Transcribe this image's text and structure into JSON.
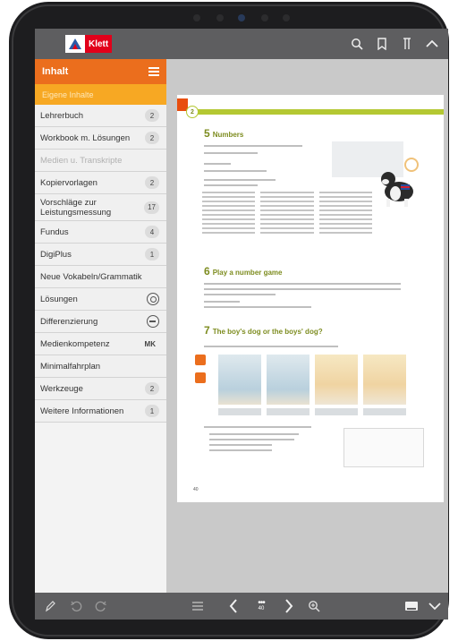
{
  "app": {
    "logo_text": "Klett",
    "brand_color": "#e2001a",
    "accent_color": "#eb6e1d"
  },
  "topbar": {
    "icons": [
      "search-icon",
      "bookmark-icon",
      "marker-icon",
      "chevron-up-icon"
    ]
  },
  "sidebar": {
    "title": "Inhalt",
    "subtitle": "Eigene Inhalte",
    "items": [
      {
        "label": "Lehrerbuch",
        "badge": "2"
      },
      {
        "label": "Workbook m. Lösungen",
        "badge": "2"
      },
      {
        "label": "Medien u. Transkripte",
        "badge": ""
      },
      {
        "label": "Kopiervorlagen",
        "badge": "2"
      },
      {
        "label": "Vorschläge zur Leistungsmessung",
        "badge": "17"
      },
      {
        "label": "Fundus",
        "badge": "4"
      },
      {
        "label": "DigiPlus",
        "badge": "1"
      },
      {
        "label": "Neue Vokabeln/Grammatik",
        "badge": ""
      },
      {
        "label": "Lösungen",
        "badge": ""
      },
      {
        "label": "Differenzierung",
        "badge": ""
      },
      {
        "label": "Medienkompetenz",
        "badge": "MK"
      },
      {
        "label": "Minimalfahrplan",
        "badge": ""
      },
      {
        "label": "Werkzeuge",
        "badge": "2"
      },
      {
        "label": "Weitere Informationen",
        "badge": "1"
      }
    ]
  },
  "page": {
    "unit_label": "2",
    "ex5_number": "5",
    "ex5_title": "Numbers",
    "ex6_number": "6",
    "ex6_title": "Play a number game",
    "ex7_number": "7",
    "ex7_title": "The boy's dog or the boys' dog?",
    "page_number": "40"
  },
  "bottombar": {
    "icons": [
      "pen-icon",
      "undo-icon",
      "redo-icon",
      "list-icon",
      "prev-page-icon",
      "next-page-icon",
      "zoom-icon",
      "single-page-icon",
      "chevron-down-icon"
    ],
    "page_indicator": "40"
  }
}
